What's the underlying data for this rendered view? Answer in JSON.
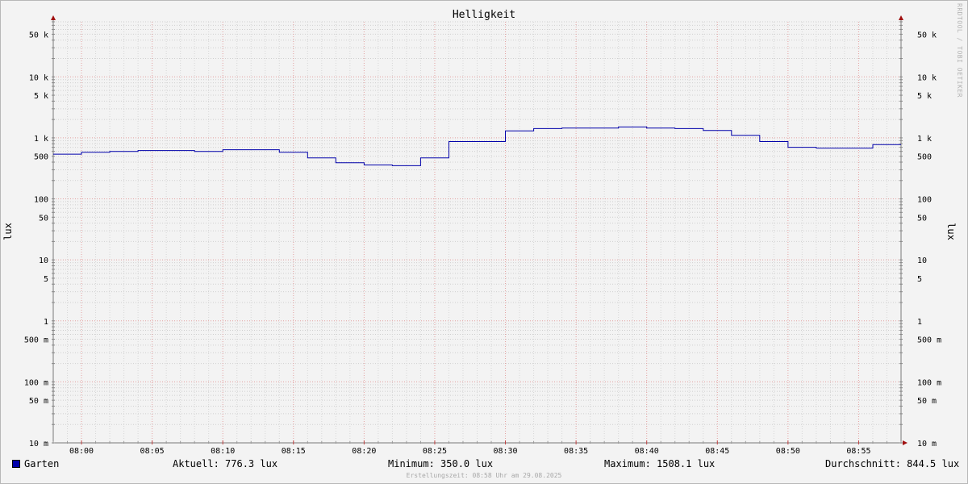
{
  "chart_data": {
    "type": "line",
    "title": "Helligkeit",
    "ylabel": "lux",
    "yscale": "log",
    "ylim": [
      0.01,
      80000
    ],
    "xlim": [
      "07:58",
      "08:58"
    ],
    "x_ticks": [
      "08:00",
      "08:05",
      "08:10",
      "08:15",
      "08:20",
      "08:25",
      "08:30",
      "08:35",
      "08:40",
      "08:45",
      "08:50",
      "08:55"
    ],
    "y_ticks": [
      {
        "value": 50000,
        "label": "50 k"
      },
      {
        "value": 10000,
        "label": "10 k"
      },
      {
        "value": 5000,
        "label": "5 k"
      },
      {
        "value": 1000,
        "label": "1 k"
      },
      {
        "value": 500,
        "label": "500"
      },
      {
        "value": 100,
        "label": "100"
      },
      {
        "value": 50,
        "label": "50"
      },
      {
        "value": 10,
        "label": "10"
      },
      {
        "value": 5,
        "label": "5"
      },
      {
        "value": 1,
        "label": "1"
      },
      {
        "value": 0.5,
        "label": "500 m"
      },
      {
        "value": 0.1,
        "label": "100 m"
      },
      {
        "value": 0.05,
        "label": "50 m"
      },
      {
        "value": 0.01,
        "label": "10 m"
      }
    ],
    "grid": true,
    "series": [
      {
        "name": "Garten",
        "color": "#0000aa",
        "x": [
          "07:58",
          "08:00",
          "08:02",
          "08:04",
          "08:06",
          "08:08",
          "08:10",
          "08:12",
          "08:14",
          "08:16",
          "08:18",
          "08:20",
          "08:22",
          "08:24",
          "08:26",
          "08:28",
          "08:30",
          "08:32",
          "08:34",
          "08:36",
          "08:38",
          "08:40",
          "08:42",
          "08:44",
          "08:46",
          "08:48",
          "08:50",
          "08:52",
          "08:54",
          "08:56"
        ],
        "values": [
          540,
          580,
          600,
          620,
          620,
          600,
          640,
          640,
          580,
          470,
          390,
          360,
          350,
          470,
          870,
          870,
          1300,
          1420,
          1450,
          1450,
          1508.1,
          1450,
          1420,
          1320,
          1100,
          870,
          700,
          680,
          680,
          776.3
        ]
      }
    ]
  },
  "legend": {
    "series_name": "Garten",
    "current": "Aktuell: 776.3 lux",
    "minimum": "Minimum: 350.0 lux",
    "maximum": "Maximum: 1508.1 lux",
    "average": "Durchschnitt: 844.5 lux"
  },
  "watermark": "RRDTOOL / TOBI OETIKER",
  "footer": "Erstellungszeit: 08:58 Uhr am 29.08.2025"
}
